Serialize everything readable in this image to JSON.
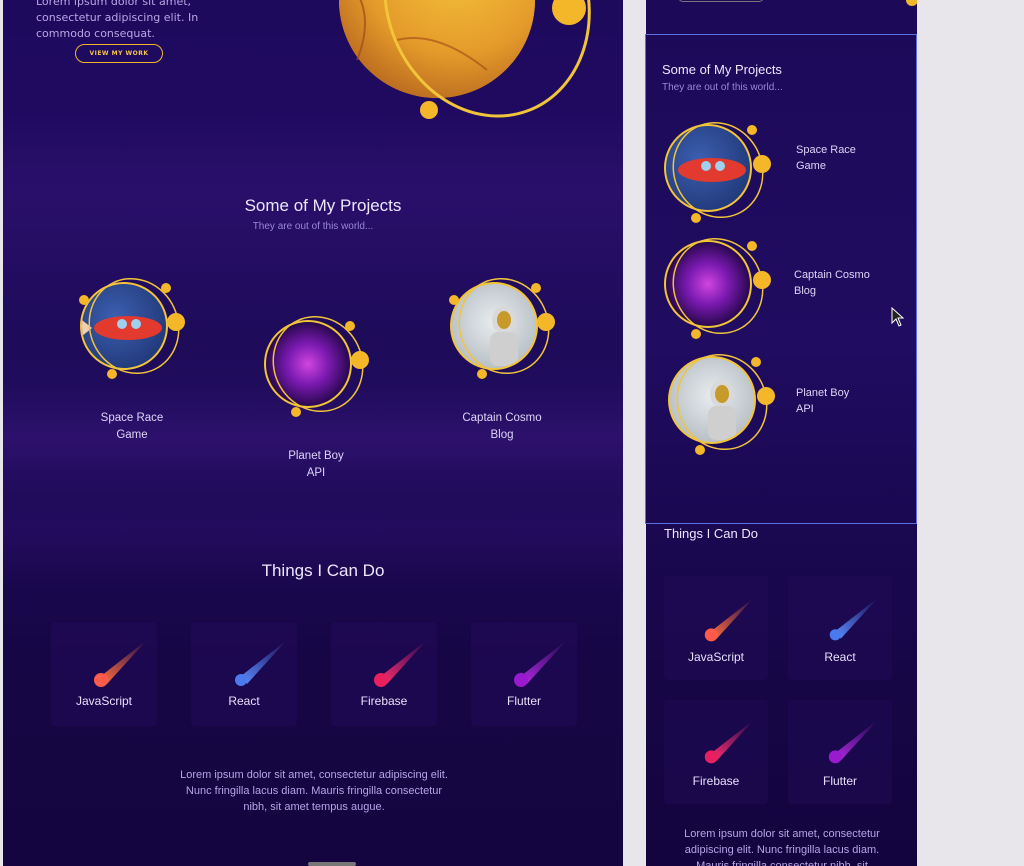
{
  "hero": {
    "text": "Lorem ipsum dolor sit amet, consectetur adipiscing elit. In commodo consequat.",
    "button_label": "VIEW MY WORK"
  },
  "projects": {
    "title": "Some of My Projects",
    "subtitle": "They are out of this world...",
    "items": [
      {
        "label": "Space Race\nGame",
        "image": "rocket-image"
      },
      {
        "label": "Planet Boy\nAPI",
        "image": "nebula-image"
      },
      {
        "label": "Captain Cosmo\nBlog",
        "image": "astronaut-image"
      }
    ]
  },
  "skills": {
    "title": "Things I Can Do",
    "items": [
      {
        "label": "JavaScript",
        "color": "#ff7a3c"
      },
      {
        "label": "React",
        "color": "#5a8dff"
      },
      {
        "label": "Firebase",
        "color": "#ff2d7a"
      },
      {
        "label": "Flutter",
        "color": "#b02ae0"
      }
    ]
  },
  "footer_text": "Lorem ipsum dolor sit amet, consectetur adipiscing elit. Nunc fringilla lacus diam. Mauris fringilla consectetur nibh, sit amet tempus augue.",
  "mobile": {
    "projects_title": "Some of My Projects",
    "projects_subtitle": "They are out of this world...",
    "items": [
      {
        "label": "Space Race\nGame"
      },
      {
        "label": "Captain Cosmo\nBlog"
      },
      {
        "label": "Planet Boy\nAPI"
      }
    ],
    "skills_title": "Things I Can Do",
    "skills": [
      "JavaScript",
      "React",
      "Firebase",
      "Flutter"
    ],
    "footer_text": "Lorem ipsum dolor sit amet, consectetur adipiscing elit. Nunc fringilla lacus diam. Mauris fringilla consectetur nibh, sit"
  },
  "colors": {
    "accent": "#f2b62e",
    "bg": "#1e0a5c"
  }
}
